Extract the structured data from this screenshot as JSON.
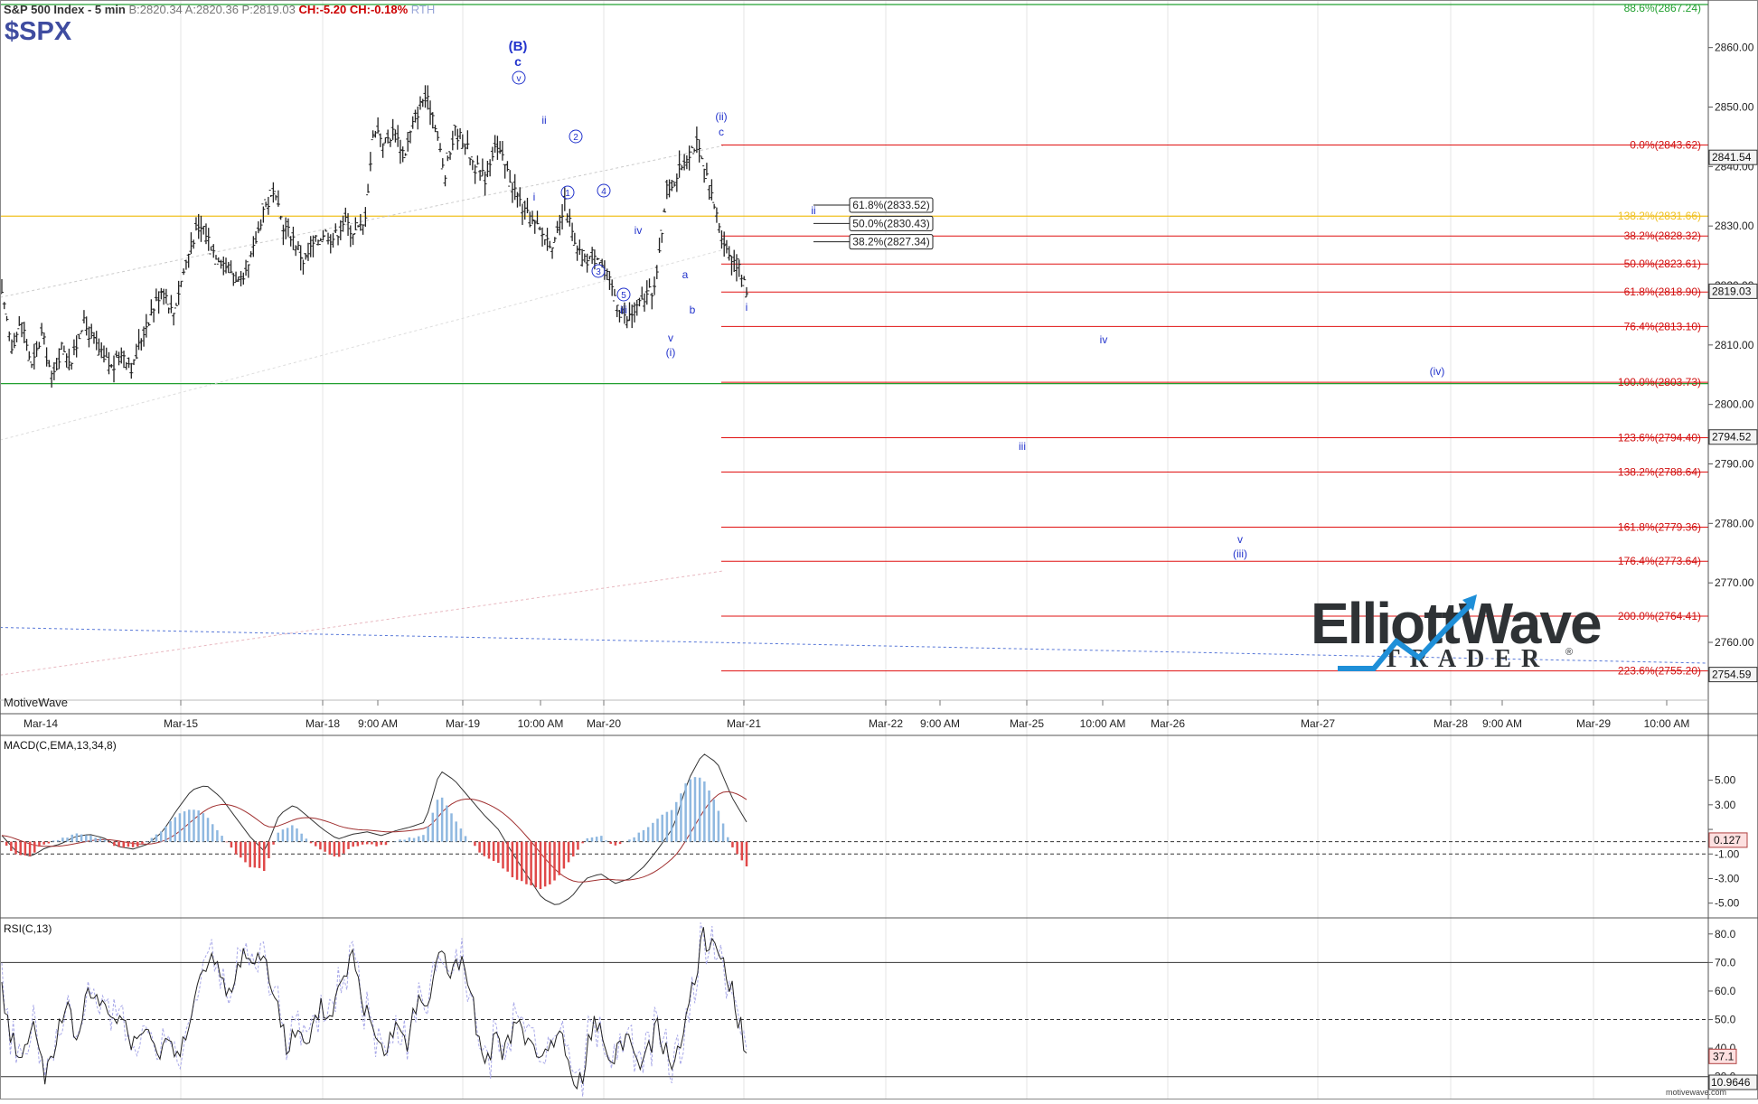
{
  "header": {
    "title": "S&P 500 Index - 5 min",
    "quote": "B:2820.34 A:2820.36 P:2819.03",
    "change": "CH:-5.20",
    "change_pct": "CH:-0.18%",
    "session": "RTH",
    "symbol": "$SPX"
  },
  "branding": {
    "platform": "MotiveWave",
    "site": "motivewave.com",
    "logo_word1": "ElliottWave",
    "logo_word2": "TRADER",
    "logo_mark": "®"
  },
  "colors": {
    "bar": "#222222",
    "fib": "#e01010",
    "fib_text": "#d01010",
    "wave": "#2233cc",
    "gold": "#f0c020",
    "green": "#22a030",
    "macd_pos": "#8fb8e0",
    "macd_neg": "#e04848",
    "logo_blue": "#1e8fd8"
  },
  "chart_data": [
    {
      "type": "candlestick",
      "title": "S&P 500 Index - 5 min",
      "interval": "5 min",
      "y_scale": "linear",
      "ylim": [
        2748,
        2868
      ],
      "y_ticks": [
        2760,
        2770,
        2780,
        2790,
        2800,
        2810,
        2820,
        2830,
        2840,
        2850,
        2860
      ],
      "y_tick_labels": [
        "2760.00",
        "2770.00",
        "2780.00",
        "2790.00",
        "2800.00",
        "2810.00",
        "2820.00",
        "2830.00",
        "2840.00",
        "2850.00",
        "2860.00"
      ],
      "x_labels": [
        "Mar-14",
        "Mar-15",
        "Mar-18",
        "9:00 AM",
        "Mar-19",
        "10:00 AM",
        "Mar-20",
        "Mar-21",
        "Mar-22",
        "9:00 AM",
        "Mar-25",
        "10:00 AM",
        "Mar-26",
        "Mar-27",
        "Mar-28",
        "9:00 AM",
        "Mar-29",
        "10:00 AM"
      ],
      "price_path": [
        2818,
        2810,
        2814,
        2806,
        2812,
        2804,
        2810,
        2807,
        2814,
        2811,
        2808,
        2806,
        2809,
        2806,
        2812,
        2816,
        2820,
        2815,
        2822,
        2828,
        2830,
        2826,
        2824,
        2822,
        2820,
        2826,
        2833,
        2835,
        2830,
        2828,
        2824,
        2827,
        2829,
        2828,
        2831,
        2829,
        2830,
        2847,
        2844,
        2846,
        2842,
        2848,
        2852,
        2848,
        2838,
        2846,
        2844,
        2840,
        2838,
        2844,
        2840,
        2836,
        2832,
        2830,
        2828,
        2827,
        2834,
        2826,
        2824,
        2826,
        2822,
        2818,
        2814,
        2816,
        2818,
        2820,
        2836,
        2838,
        2842,
        2844,
        2838,
        2832,
        2826,
        2824,
        2819
      ],
      "last_price": 2819.03,
      "price_tags": [
        {
          "value": 2841.54,
          "label": "2841.54"
        },
        {
          "value": 2819.03,
          "label": "2819.03"
        },
        {
          "value": 2794.52,
          "label": "2794.52"
        },
        {
          "value": 2754.59,
          "label": "2754.59"
        }
      ],
      "fib_extensions": [
        {
          "value": 2843.62,
          "label": "0.0%(2843.62)"
        },
        {
          "value": 2828.32,
          "label": "38.2%(2828.32)"
        },
        {
          "value": 2823.61,
          "label": "50.0%(2823.61)"
        },
        {
          "value": 2818.9,
          "label": "61.8%(2818.90)"
        },
        {
          "value": 2813.1,
          "label": "76.4%(2813.10)"
        },
        {
          "value": 2803.73,
          "label": "100.0%(2803.73)"
        },
        {
          "value": 2794.4,
          "label": "123.6%(2794.40)"
        },
        {
          "value": 2788.64,
          "label": "138.2%(2788.64)"
        },
        {
          "value": 2779.36,
          "label": "161.8%(2779.36)"
        },
        {
          "value": 2773.64,
          "label": "176.4%(2773.64)"
        },
        {
          "value": 2764.41,
          "label": "200.0%(2764.41)"
        },
        {
          "value": 2755.2,
          "label": "223.6%(2755.20)"
        }
      ],
      "fib_retracements": [
        {
          "value": 2833.52,
          "label": "61.8%(2833.52)"
        },
        {
          "value": 2830.43,
          "label": "50.0%(2830.43)"
        },
        {
          "value": 2827.34,
          "label": "38.2%(2827.34)"
        }
      ],
      "horizontal_lines": [
        {
          "value": 2831.66,
          "label": "138.2%(2831.66)",
          "color": "gold"
        },
        {
          "value": 2867.24,
          "label": "88.6%(2867.24)",
          "color": "green"
        },
        {
          "value": 2803.5,
          "label": "",
          "color": "green"
        }
      ],
      "wave_labels": [
        "(B)",
        "c",
        "v",
        "ii",
        "2",
        "i",
        "1",
        "4",
        "3",
        "iv",
        "5",
        "iii",
        "v",
        "(i)",
        "a",
        "b",
        "(ii)",
        "c",
        "i",
        "ii",
        "iv",
        "(iv)",
        "iii",
        "v",
        "(iii)"
      ]
    },
    {
      "type": "macd",
      "title": "MACD(C,EMA,13,34,8)",
      "ylim": [
        -6.2,
        8.5
      ],
      "y_ticks": [
        5,
        3,
        1,
        -1,
        -3,
        -5
      ],
      "y_tick_labels": [
        "5.00",
        "3.00",
        "",
        "-1.00",
        "-3.00",
        "-5.00"
      ],
      "last_value": 0.127,
      "last_label": "0.127",
      "macd_path": [
        0.5,
        -0.8,
        -1.2,
        -0.5,
        -0.2,
        0.4,
        0.6,
        0.3,
        -0.4,
        -0.6,
        -0.2,
        0.8,
        2.6,
        4.2,
        4.6,
        3.6,
        2.0,
        0.4,
        -0.8,
        2.2,
        3.0,
        2.0,
        1.0,
        0.2,
        0.6,
        0.8,
        0.5,
        0.9,
        1.2,
        1.6,
        5.8,
        5.0,
        3.6,
        2.2,
        1.0,
        -1.0,
        -2.8,
        -4.6,
        -5.2,
        -4.5,
        -3.0,
        -2.6,
        -3.4,
        -3.0,
        -2.0,
        -0.5,
        1.2,
        5.0,
        7.2,
        6.4,
        3.6,
        1.6
      ]
    },
    {
      "type": "rsi",
      "title": "RSI(C,13)",
      "ylim": [
        22,
        85
      ],
      "y_ticks": [
        80,
        70,
        60,
        50,
        40,
        30
      ],
      "y_tick_labels": [
        "80.0",
        "70.0",
        "60.0",
        "50.0",
        "40.0",
        "30.0"
      ],
      "levels": [
        70,
        50,
        30
      ],
      "last_value": 37.1,
      "last_label": "37.1",
      "secondary_label": "10.9646",
      "rsi_path": [
        60,
        42,
        38,
        48,
        30,
        45,
        52,
        44,
        62,
        55,
        48,
        52,
        40,
        46,
        38,
        44,
        36,
        50,
        62,
        70,
        65,
        58,
        75,
        70,
        72,
        60,
        40,
        45,
        38,
        55,
        50,
        65,
        72,
        55,
        48,
        40,
        50,
        42,
        60,
        52,
        78,
        65,
        70,
        55,
        30,
        45,
        38,
        50,
        42,
        35,
        40,
        45,
        30,
        28,
        50,
        42,
        38,
        45,
        35,
        40,
        48,
        32,
        45,
        60,
        80,
        75,
        70,
        55,
        37
      ]
    }
  ]
}
